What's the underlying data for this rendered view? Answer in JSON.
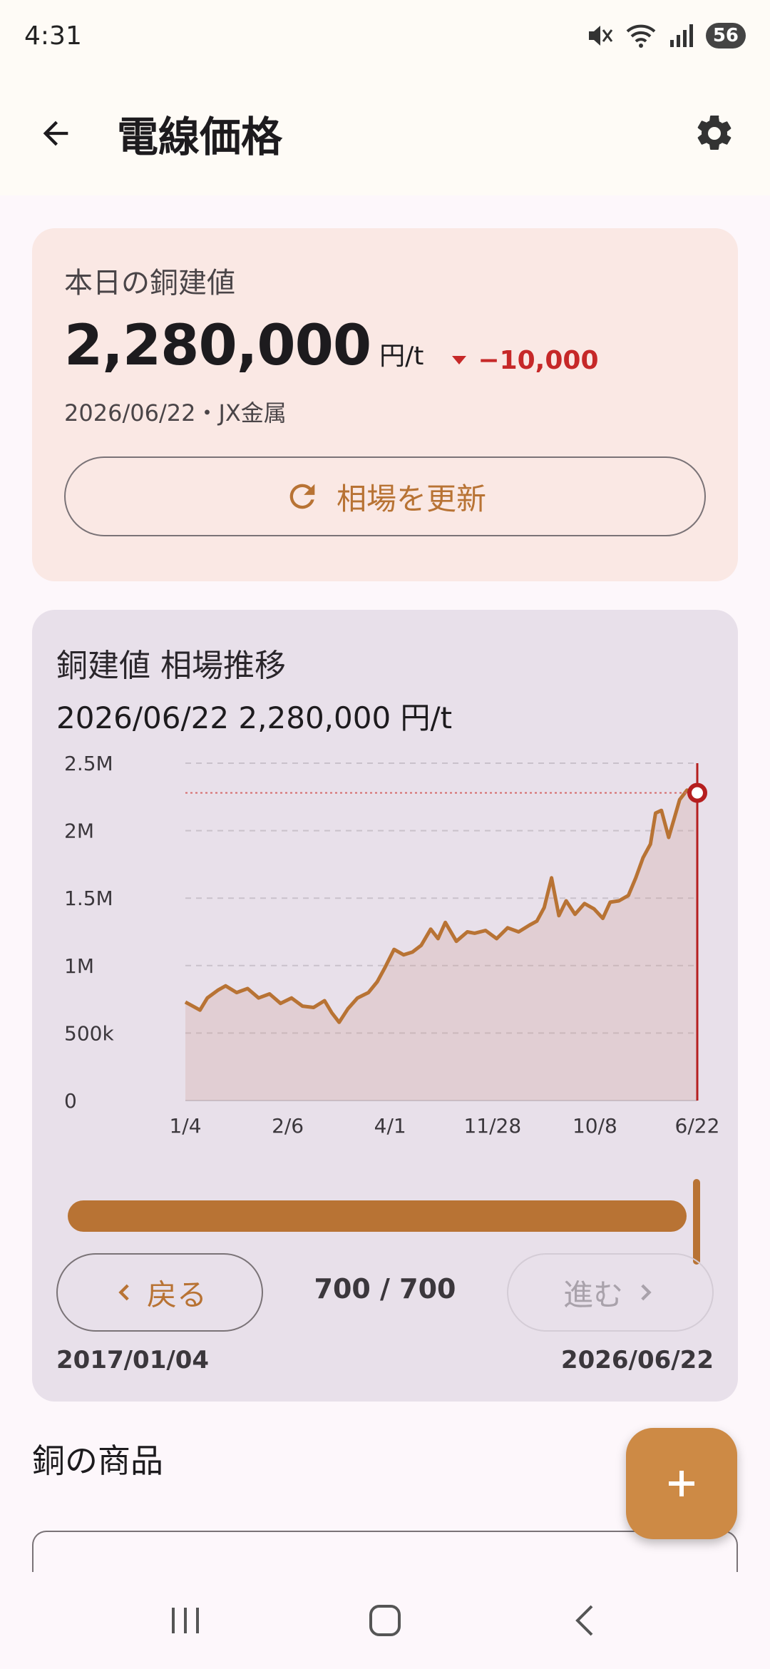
{
  "status_bar": {
    "time": "4:31",
    "battery": "56",
    "icons": [
      "mute-icon",
      "wifi-icon",
      "signal-icon",
      "battery-icon"
    ]
  },
  "app_bar": {
    "title": "電線価格",
    "back_icon": "arrow-left-icon",
    "settings_icon": "gear-icon"
  },
  "price_card": {
    "label": "本日の銅建値",
    "price": "2,280,000",
    "unit": "円/t",
    "change": "−10,000",
    "change_direction": "down",
    "source": "2026/06/22・JX金属",
    "refresh_label": "相場を更新",
    "refresh_icon": "refresh-icon",
    "colors": {
      "background": "#fae8e4",
      "accent": "#b87334",
      "down": "#c62828"
    }
  },
  "chart_card": {
    "title": "銅建値 相場推移",
    "selected_info": "2026/06/22  2,280,000 円/t",
    "slider_value": 1.0,
    "nav": {
      "prev_label": "戻る",
      "next_label": "進む",
      "position": "700 / 700",
      "next_enabled": false
    },
    "start_date": "2017/01/04",
    "end_date": "2026/06/22"
  },
  "chart_data": {
    "type": "area",
    "title": "",
    "xlabel": "",
    "ylabel": "",
    "ylim": [
      0,
      2500000
    ],
    "y_ticks": [
      "0",
      "500k",
      "1M",
      "1.5M",
      "2M",
      "2.5M"
    ],
    "x_ticks": [
      "1/4",
      "2/6",
      "4/1",
      "11/28",
      "10/8",
      "6/22"
    ],
    "grid": true,
    "reference_line": 2280000,
    "selected_point": {
      "index": 699,
      "value": 2280000
    },
    "total_points": 700,
    "series": [
      {
        "color": "#b87334",
        "points": [
          [
            0,
            730000
          ],
          [
            10,
            700000
          ],
          [
            20,
            670000
          ],
          [
            30,
            760000
          ],
          [
            45,
            820000
          ],
          [
            55,
            850000
          ],
          [
            70,
            800000
          ],
          [
            85,
            830000
          ],
          [
            100,
            760000
          ],
          [
            115,
            790000
          ],
          [
            130,
            720000
          ],
          [
            145,
            760000
          ],
          [
            160,
            700000
          ],
          [
            175,
            690000
          ],
          [
            190,
            740000
          ],
          [
            200,
            650000
          ],
          [
            210,
            580000
          ],
          [
            222,
            680000
          ],
          [
            235,
            760000
          ],
          [
            250,
            800000
          ],
          [
            262,
            880000
          ],
          [
            272,
            980000
          ],
          [
            285,
            1120000
          ],
          [
            298,
            1080000
          ],
          [
            310,
            1100000
          ],
          [
            322,
            1150000
          ],
          [
            335,
            1270000
          ],
          [
            345,
            1200000
          ],
          [
            355,
            1320000
          ],
          [
            370,
            1180000
          ],
          [
            385,
            1250000
          ],
          [
            395,
            1240000
          ],
          [
            410,
            1260000
          ],
          [
            425,
            1200000
          ],
          [
            440,
            1280000
          ],
          [
            455,
            1250000
          ],
          [
            470,
            1300000
          ],
          [
            480,
            1330000
          ],
          [
            490,
            1430000
          ],
          [
            500,
            1650000
          ],
          [
            510,
            1370000
          ],
          [
            520,
            1480000
          ],
          [
            532,
            1380000
          ],
          [
            545,
            1460000
          ],
          [
            558,
            1420000
          ],
          [
            570,
            1350000
          ],
          [
            580,
            1470000
          ],
          [
            592,
            1480000
          ],
          [
            605,
            1520000
          ],
          [
            615,
            1650000
          ],
          [
            625,
            1800000
          ],
          [
            635,
            1900000
          ],
          [
            642,
            2130000
          ],
          [
            650,
            2150000
          ],
          [
            660,
            1950000
          ],
          [
            668,
            2100000
          ],
          [
            675,
            2230000
          ],
          [
            685,
            2300000
          ],
          [
            692,
            2250000
          ],
          [
            699,
            2280000
          ]
        ]
      }
    ]
  },
  "products_section": {
    "title": "銅の商品",
    "fab_icon": "plus-icon"
  },
  "system_nav": {
    "icons": [
      "recent-apps-icon",
      "home-icon",
      "back-nav-icon"
    ]
  }
}
